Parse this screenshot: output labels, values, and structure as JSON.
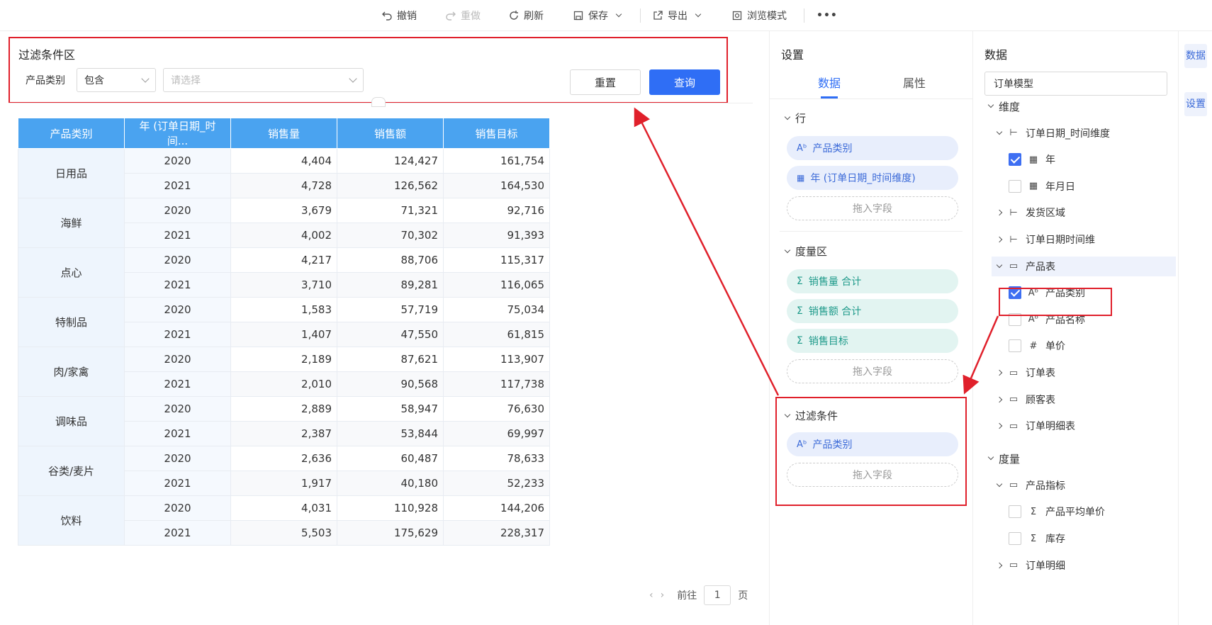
{
  "toolbar": {
    "undo": "撤销",
    "redo": "重做",
    "refresh": "刷新",
    "save": "保存",
    "export": "导出",
    "browse": "浏览模式",
    "more": "•••"
  },
  "filter": {
    "title": "过滤条件区",
    "field_label": "产品类别",
    "operator": "包含",
    "value_placeholder": "请选择",
    "reset": "重置",
    "query": "查询"
  },
  "table": {
    "headers": [
      "产品类别",
      "年 (订单日期_时间...",
      "销售量",
      "销售额",
      "销售目标"
    ],
    "groups": [
      {
        "category": "日用品",
        "rows": [
          [
            "2020",
            "4,404",
            "124,427",
            "161,754"
          ],
          [
            "2021",
            "4,728",
            "126,562",
            "164,530"
          ]
        ]
      },
      {
        "category": "海鲜",
        "rows": [
          [
            "2020",
            "3,679",
            "71,321",
            "92,716"
          ],
          [
            "2021",
            "4,002",
            "70,302",
            "91,393"
          ]
        ]
      },
      {
        "category": "点心",
        "rows": [
          [
            "2020",
            "4,217",
            "88,706",
            "115,317"
          ],
          [
            "2021",
            "3,710",
            "89,281",
            "116,065"
          ]
        ]
      },
      {
        "category": "特制品",
        "rows": [
          [
            "2020",
            "1,583",
            "57,719",
            "75,034"
          ],
          [
            "2021",
            "1,407",
            "47,550",
            "61,815"
          ]
        ]
      },
      {
        "category": "肉/家禽",
        "rows": [
          [
            "2020",
            "2,189",
            "87,621",
            "113,907"
          ],
          [
            "2021",
            "2,010",
            "90,568",
            "117,738"
          ]
        ]
      },
      {
        "category": "调味品",
        "rows": [
          [
            "2020",
            "2,889",
            "58,947",
            "76,630"
          ],
          [
            "2021",
            "2,387",
            "53,844",
            "69,997"
          ]
        ]
      },
      {
        "category": "谷类/麦片",
        "rows": [
          [
            "2020",
            "2,636",
            "60,487",
            "78,633"
          ],
          [
            "2021",
            "1,917",
            "40,180",
            "52,233"
          ]
        ]
      },
      {
        "category": "饮料",
        "rows": [
          [
            "2020",
            "4,031",
            "110,928",
            "144,206"
          ],
          [
            "2021",
            "5,503",
            "175,629",
            "228,317"
          ]
        ]
      }
    ]
  },
  "pagination": {
    "goto_label": "前往",
    "page": "1",
    "page_suffix": "页"
  },
  "settings": {
    "title": "设置",
    "tab_data": "数据",
    "tab_props": "属性",
    "rows_section": "行",
    "row_fields": [
      "产品类别",
      "年 (订单日期_时间维度)"
    ],
    "drop_hint": "拖入字段",
    "measure_section": "度量区",
    "measure_fields": [
      "销售量 合计",
      "销售额 合计",
      "销售目标"
    ],
    "filter_section": "过滤条件",
    "filter_fields": [
      "产品类别"
    ]
  },
  "datapanel": {
    "title": "数据",
    "model": "订单模型",
    "dimensions": "维度",
    "dim_items": [
      {
        "label": "订单日期_时间维度",
        "type": "hierarchy",
        "expanded": true
      },
      {
        "label": "年",
        "type": "date",
        "checked": true
      },
      {
        "label": "年月日",
        "type": "date",
        "checked": false
      },
      {
        "label": "发货区域",
        "type": "hierarchy",
        "expanded": false
      },
      {
        "label": "订单日期时间维",
        "type": "hierarchy",
        "expanded": false
      },
      {
        "label": "产品表",
        "type": "folder",
        "expanded": true
      },
      {
        "label": "产品类别",
        "type": "text",
        "checked": true
      },
      {
        "label": "产品名称",
        "type": "text",
        "checked": false
      },
      {
        "label": "单价",
        "type": "number",
        "checked": false
      },
      {
        "label": "订单表",
        "type": "folder",
        "expanded": false
      },
      {
        "label": "顾客表",
        "type": "folder",
        "expanded": false
      },
      {
        "label": "订单明细表",
        "type": "folder",
        "expanded": false
      }
    ],
    "measures": "度量",
    "measure_items": [
      {
        "label": "产品指标",
        "type": "folder",
        "expanded": true
      },
      {
        "label": "产品平均单价",
        "type": "sum",
        "checked": false
      },
      {
        "label": "库存",
        "type": "sum",
        "checked": false
      },
      {
        "label": "订单明细",
        "type": "folder",
        "expanded": false
      }
    ]
  },
  "side_tabs": [
    "数据",
    "设置"
  ],
  "colors": {
    "accent": "#3e6ff2",
    "highlight": "#e0202b",
    "header": "#4aa3f0"
  }
}
